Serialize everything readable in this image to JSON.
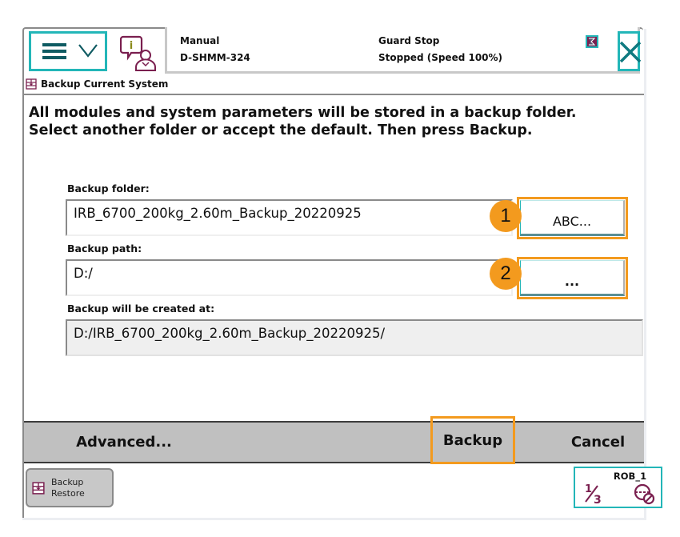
{
  "header": {
    "mode": "Manual",
    "system_name": "D-SHMM-324",
    "safety_state": "Guard Stop",
    "run_state": "Stopped (Speed 100%)"
  },
  "app": {
    "title": "Backup Current System"
  },
  "instructions": {
    "line1": "All modules and system parameters will be stored in a backup folder.",
    "line2": "Select another folder or accept the default. Then press Backup."
  },
  "form": {
    "folder_label": "Backup folder:",
    "folder_value": "IRB_6700_200kg_2.60m_Backup_20220925",
    "folder_button": "ABC...",
    "path_label": "Backup path:",
    "path_value": "D:/",
    "path_button": "...",
    "result_label": "Backup will be created at:",
    "result_value": "D:/IRB_6700_200kg_2.60m_Backup_20220925/"
  },
  "annotations": {
    "badge1": "1",
    "badge2": "2",
    "highlight_color": "#f39a1e"
  },
  "command_bar": {
    "advanced": "Advanced...",
    "backup": "Backup",
    "cancel": "Cancel"
  },
  "taskbar": {
    "app_line1": "Backup",
    "app_line2": "Restore"
  },
  "robot": {
    "name": "ROB_1",
    "increment": "1/3"
  },
  "colors": {
    "accent": "#23b6b8",
    "icon": "#7a1f4f",
    "command_bar": "#c0c0c0"
  }
}
